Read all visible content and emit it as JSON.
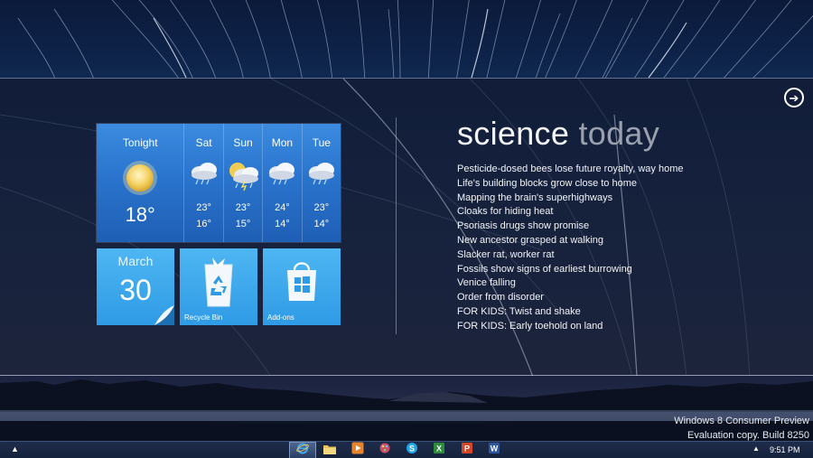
{
  "weather": {
    "days": [
      {
        "name": "Tonight",
        "icon": "sun-icon",
        "temp": "18°"
      },
      {
        "name": "Sat",
        "icon": "cloud-rain-icon",
        "hi": "23°",
        "lo": "16°"
      },
      {
        "name": "Sun",
        "icon": "sun-cloud-rain-icon",
        "hi": "23°",
        "lo": "15°"
      },
      {
        "name": "Mon",
        "icon": "cloud-rain-icon",
        "hi": "24°",
        "lo": "14°"
      },
      {
        "name": "Tue",
        "icon": "cloud-rain-icon",
        "hi": "23°",
        "lo": "14°"
      }
    ]
  },
  "calendar": {
    "month": "March",
    "day": "30"
  },
  "recycle_bin": {
    "label": "Recycle Bin",
    "icon": "recycle-bin-icon"
  },
  "addons": {
    "label": "Add-ons",
    "icon": "store-bag-icon"
  },
  "science": {
    "title_part1": "science",
    "title_part2": "today",
    "headlines": [
      "Pesticide-dosed bees lose future royalty, way home",
      "Life's building blocks grow close to home",
      "Mapping the brain's superhighways",
      "Cloaks for hiding heat",
      "Psoriasis drugs show promise",
      "New ancestor grasped at walking",
      "Slacker rat, worker rat",
      "Fossils show signs of earliest burrowing",
      "Venice falling",
      "Order from disorder",
      "FOR KIDS: Twist and shake",
      "FOR KIDS: Early toehold on land"
    ]
  },
  "watermark": {
    "line1": "Windows 8 Consumer Preview",
    "line2": "Evaluation copy. Build 8250"
  },
  "taskbar": {
    "apps": [
      "internet-explorer-icon",
      "file-explorer-icon",
      "media-player-icon",
      "paint-icon",
      "skype-icon",
      "excel-icon",
      "powerpoint-icon",
      "word-icon"
    ],
    "clock": "9:51 PM"
  },
  "colors": {
    "tile_blue": "#2f9be6",
    "weather_blue": "#2a74cd",
    "excel_green": "#2e8b3a",
    "powerpoint_orange": "#d24726",
    "word_blue": "#2b579a"
  }
}
